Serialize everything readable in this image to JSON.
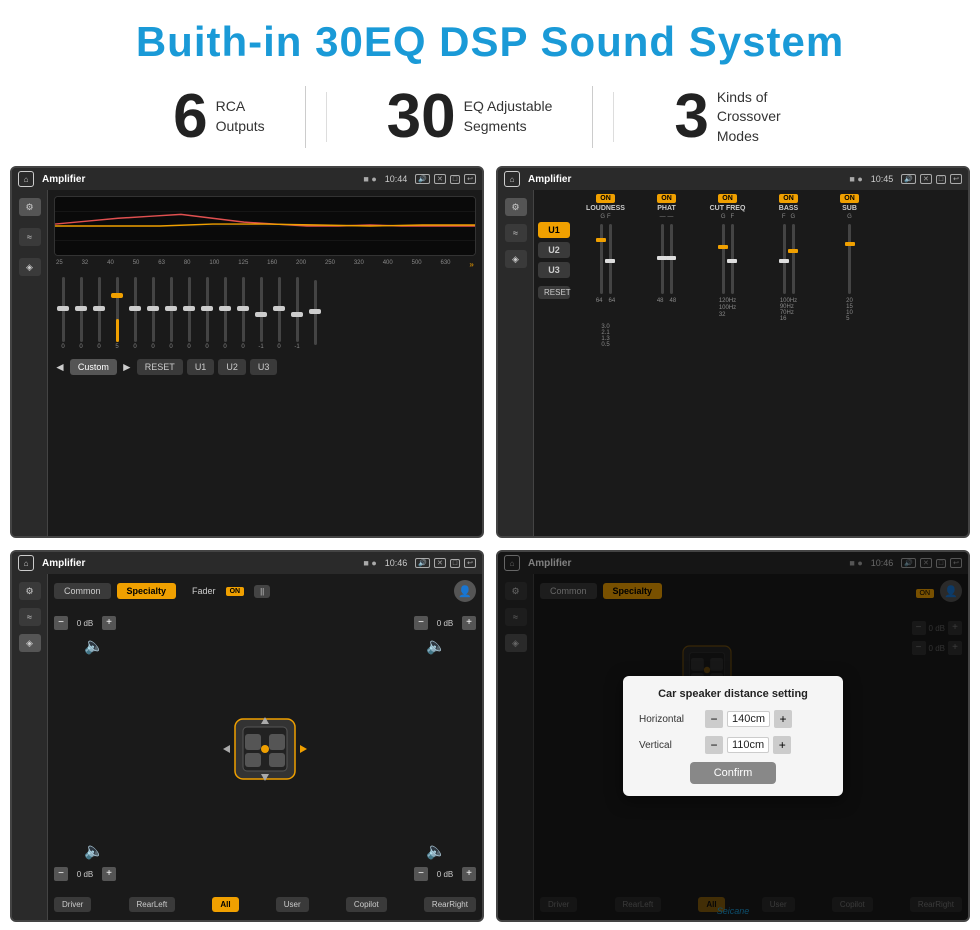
{
  "page": {
    "title": "Buith-in 30EQ DSP Sound System",
    "background": "#ffffff"
  },
  "features": [
    {
      "number": "6",
      "label": "RCA\nOutputs"
    },
    {
      "number": "30",
      "label": "EQ Adjustable\nSegments"
    },
    {
      "number": "3",
      "label": "Kinds of\nCrossover Modes"
    }
  ],
  "screens": {
    "screen1": {
      "statusbar": {
        "appname": "Amplifier",
        "time": "10:44"
      },
      "eq_freqs": [
        "25",
        "32",
        "40",
        "50",
        "63",
        "80",
        "100",
        "125",
        "160",
        "200",
        "250",
        "320",
        "400",
        "500",
        "630"
      ],
      "eq_values": [
        "0",
        "0",
        "0",
        "5",
        "0",
        "0",
        "0",
        "0",
        "0",
        "0",
        "0",
        "-1",
        "0",
        "-1",
        ""
      ],
      "buttons": {
        "back": "◄",
        "label": "Custom",
        "play": "►",
        "reset": "RESET",
        "u1": "U1",
        "u2": "U2",
        "u3": "U3"
      }
    },
    "screen2": {
      "statusbar": {
        "appname": "Amplifier",
        "time": "10:45"
      },
      "channels": {
        "loudness": "LOUDNESS",
        "phat": "PHAT",
        "cut_freq": "CUT FREQ",
        "bass": "BASS",
        "sub": "SUB"
      },
      "u_buttons": [
        "U1",
        "U2",
        "U3"
      ],
      "reset": "RESET"
    },
    "screen3": {
      "statusbar": {
        "appname": "Amplifier",
        "time": "10:46"
      },
      "tabs": [
        "Common",
        "Specialty"
      ],
      "fader_label": "Fader",
      "on_badge": "ON",
      "db_controls": {
        "top_left": "0 dB",
        "top_right": "0 dB",
        "bottom_left": "0 dB",
        "bottom_right": "0 dB"
      },
      "bottom_buttons": [
        "Driver",
        "RearLeft",
        "All",
        "User",
        "Copilot",
        "RearRight"
      ]
    },
    "screen4": {
      "statusbar": {
        "appname": "Amplifier",
        "time": "10:46"
      },
      "tabs": [
        "Common",
        "Specialty"
      ],
      "dialog": {
        "title": "Car speaker distance setting",
        "horizontal_label": "Horizontal",
        "horizontal_value": "140cm",
        "vertical_label": "Vertical",
        "vertical_value": "110cm",
        "confirm_label": "Confirm",
        "db_right1": "0 dB",
        "db_right2": "0 dB"
      },
      "bottom_buttons": [
        "Driver",
        "RearLeft",
        "All",
        "User",
        "Copilot",
        "RearRight"
      ]
    }
  },
  "watermark": "Seicane"
}
